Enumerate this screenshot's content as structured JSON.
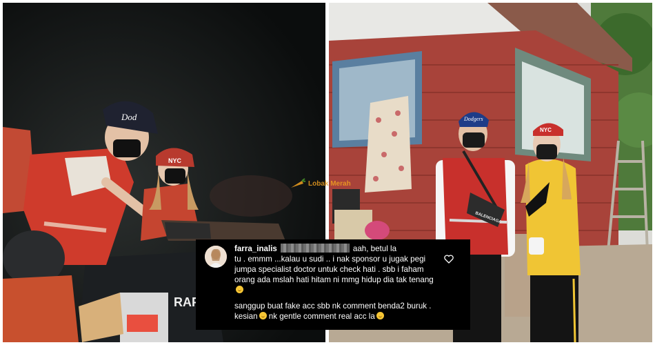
{
  "watermark": {
    "text": "Lobak Merah"
  },
  "photo_left": {
    "cap_text": "Dod",
    "cap2_text": "NYC",
    "plate_text": "RAP"
  },
  "photo_right": {
    "cap_text": "Dodgers",
    "cap2_text": "NYC",
    "bag_text": "BALENCIAGA"
  },
  "comment": {
    "username": "farra_inalis",
    "line1_tail": "aah, betul la",
    "body": "tu . emmm ...kalau u sudi .. i nak sponsor u jugak pegi jumpa specialist doctor untuk check hati .  sbb i faham orang ada mslah hati hitam ni mmg hidup dia tak tenang",
    "body2_a": "sanggup buat fake acc sbb nk comment benda2 buruk . kesian",
    "body2_b": "nk gentle comment real acc la",
    "icons": {
      "like": "heart-icon"
    }
  },
  "colors": {
    "vest_red": "#c8302c",
    "wall_red": "#a8433a",
    "comment_bg": "#000000"
  }
}
